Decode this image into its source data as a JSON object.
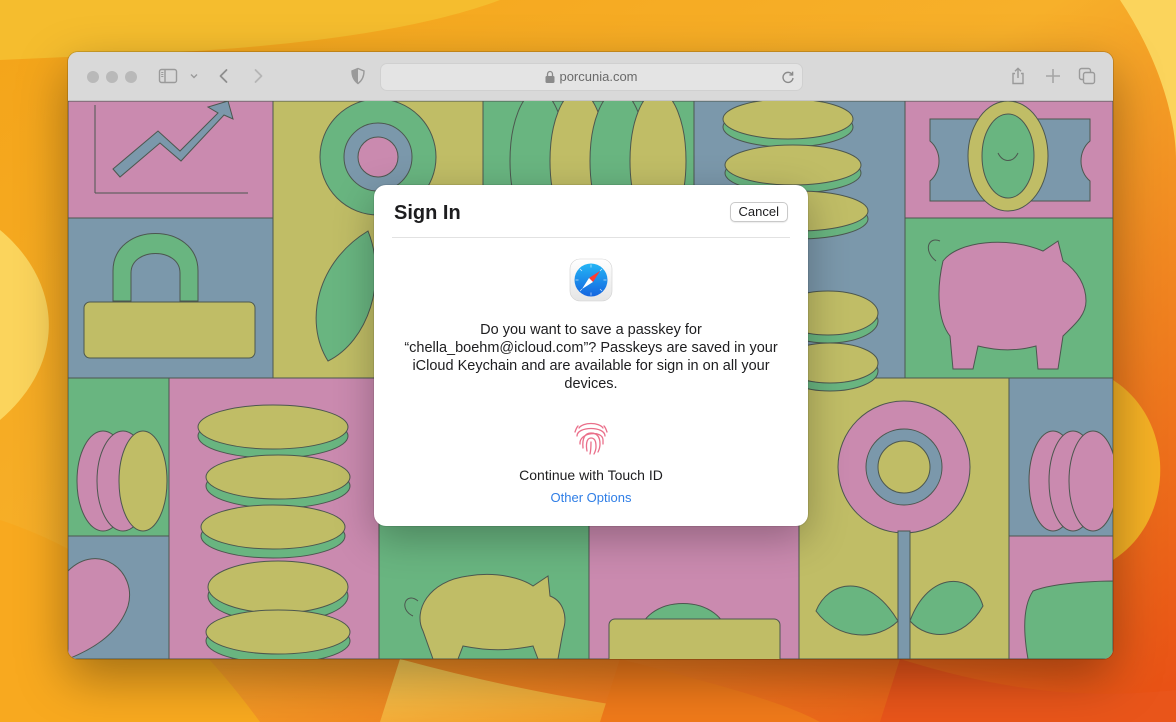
{
  "browser": {
    "address": {
      "url": "porcunia.com"
    }
  },
  "dialog": {
    "title": "Sign In",
    "cancel_label": "Cancel",
    "message": "Do you want to save a passkey for “chella_boehm@icloud.com”? Passkeys are saved in your iCloud Keychain and are available for sign in on all your devices.",
    "touch_id_label": "Continue with Touch ID",
    "other_options_label": "Other Options"
  },
  "colors": {
    "pink": "#d18fb5",
    "green": "#6dbb85",
    "yellow": "#c7c46a",
    "blue": "#7f9db1",
    "link_blue": "#2f7ee6"
  }
}
